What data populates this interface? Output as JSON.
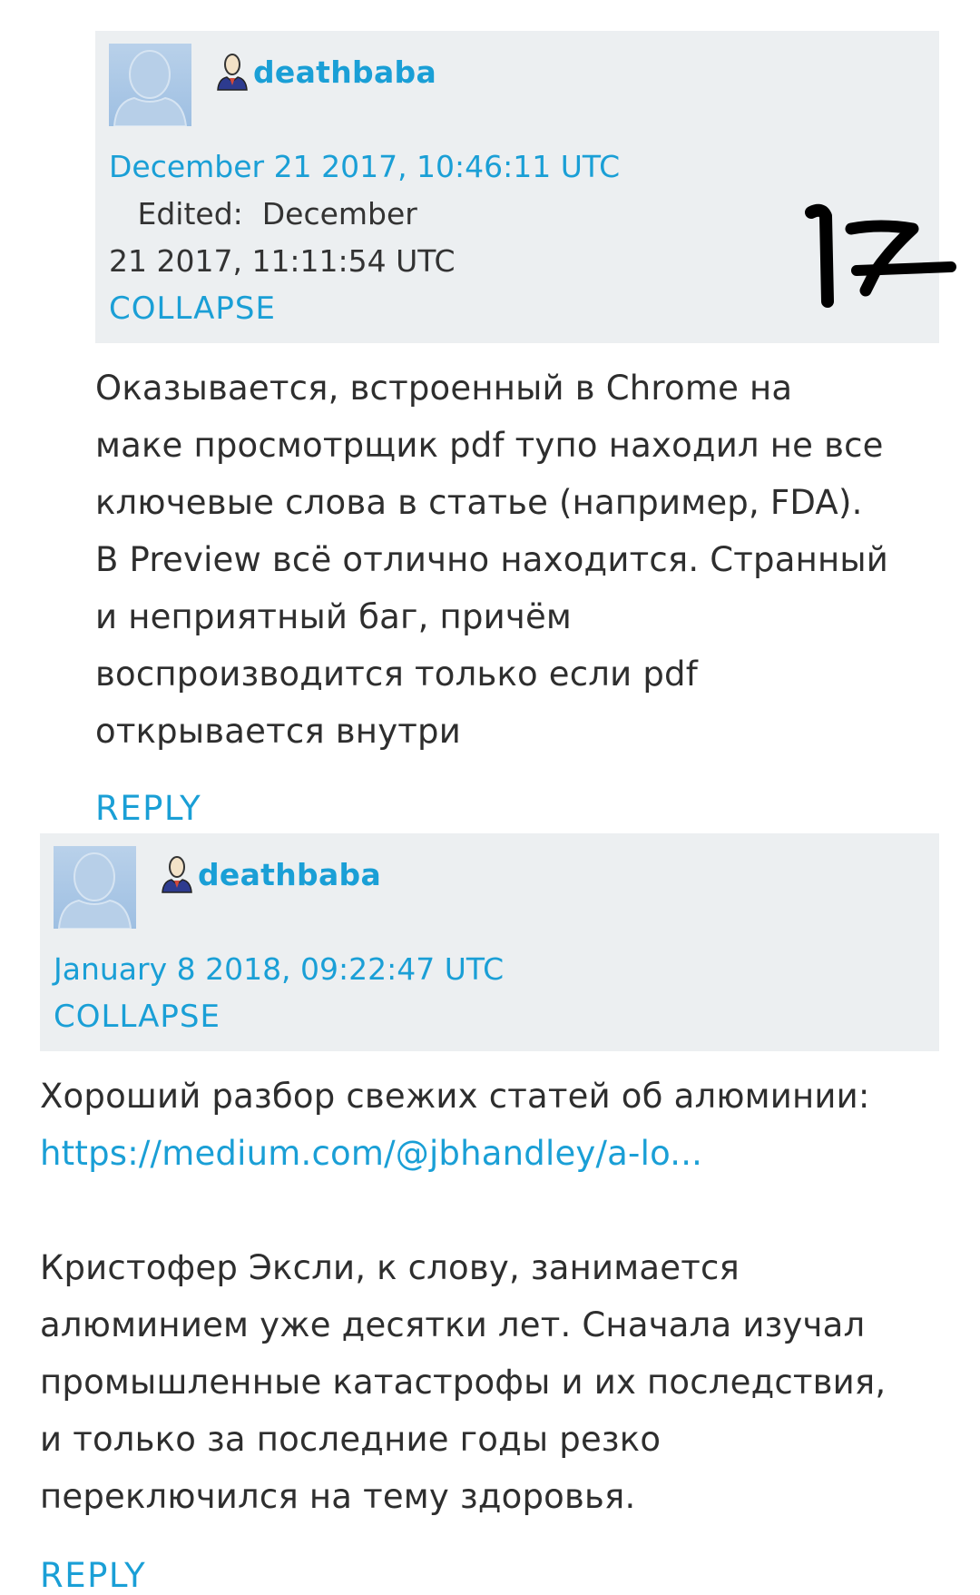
{
  "comments": [
    {
      "username": "deathbaba",
      "date": "December 21 2017, 10:46:11 UTC",
      "edited_label": "Edited:",
      "edited_date_line1": "December",
      "edited_date_line2": "21 2017, 11:11:54 UTC",
      "collapse_label": "COLLAPSE",
      "body_lines": [
        "Оказывается, встроенный в Chrome на",
        "маке просмотрщик pdf тупо находил не все",
        "ключевые слова в статье (например, FDA).",
        "В Preview всё отлично находится. Странный",
        "и неприятный баг, причём",
        "воспроизводится только если pdf",
        "открывается внутри"
      ],
      "reply_label": "REPLY"
    },
    {
      "username": "deathbaba",
      "date": "January 8 2018, 09:22:47 UTC",
      "collapse_label": "COLLAPSE",
      "body_line_1": "Хороший разбор свежих статей об алюминии:",
      "link_text": "https://medium.com/@jbhandley/a-lo...",
      "body_lines_2": [
        "Кристофер Эксли, к слову, занимается",
        "алюминием уже десятки лет. Сначала изучал",
        "промышленные катастрофы и их последствия,",
        "и только за последние годы резко",
        "переключился на тему здоровья."
      ],
      "reply_label": "REPLY"
    }
  ],
  "handwritten_annotation": "17",
  "colors": {
    "accent": "#1a9fd6",
    "header_bg": "#eceff1",
    "text": "#2e2e2e"
  },
  "icons": {
    "avatar": "default-avatar-icon",
    "user": "user-profile-icon"
  }
}
